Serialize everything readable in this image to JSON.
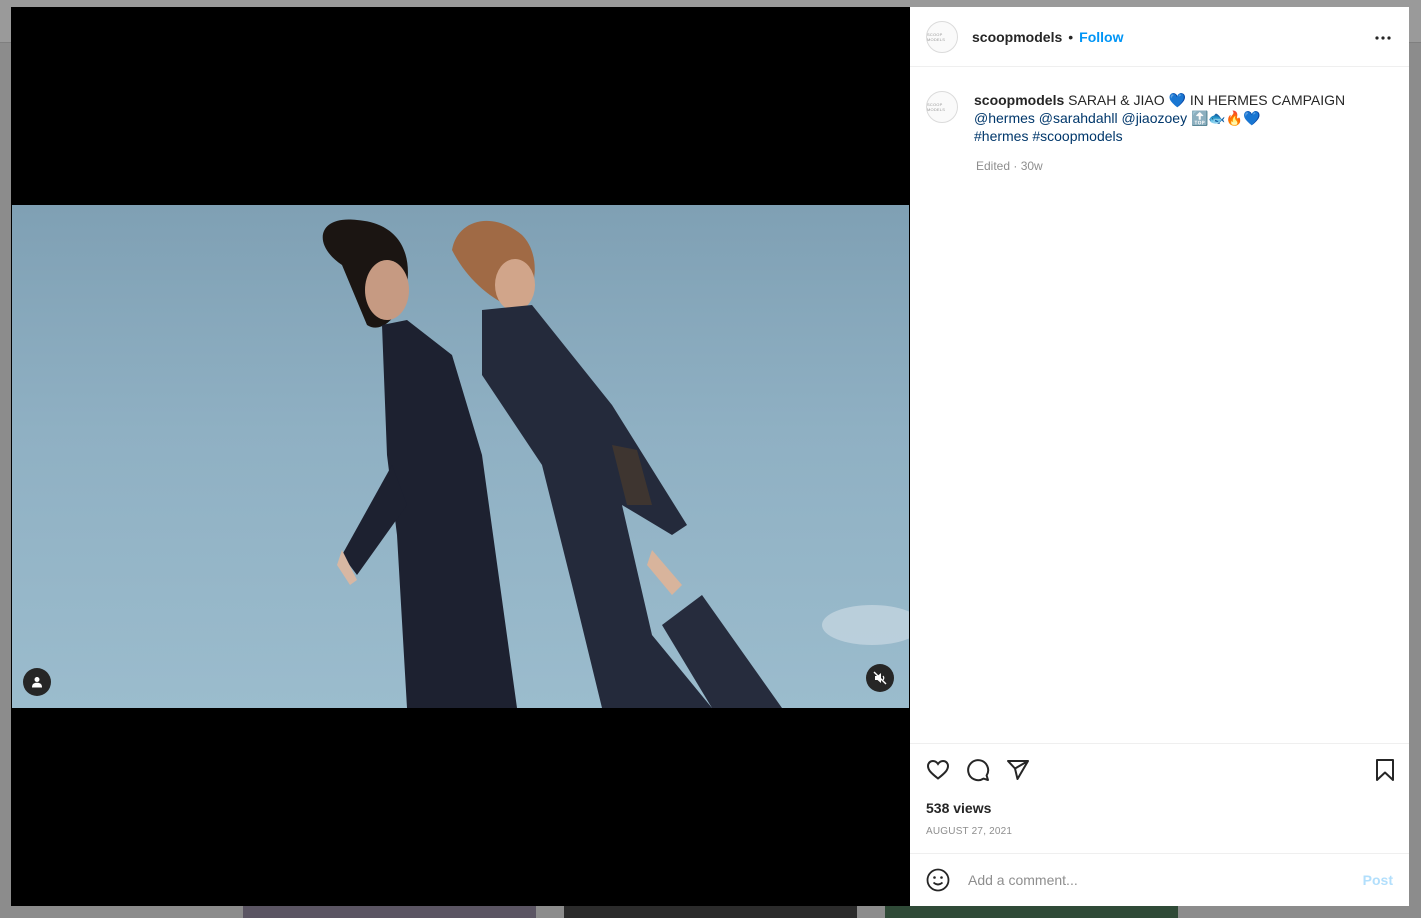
{
  "post": {
    "username": "scoopmodels",
    "dot": "•",
    "follow_label": "Follow",
    "avatar_text": "SCOOP MODELS",
    "caption": {
      "username": "scoopmodels",
      "line1_text": " SARAH & JIAO 💙 IN HERMES CAMPAIGN",
      "mentions": [
        "@hermes",
        "@sarahdahll",
        "@jiaozoey"
      ],
      "line2_emojis": "🔝🐟🔥💙",
      "hashtags": [
        "#hermes",
        "#scoopmodels"
      ]
    },
    "edited": "Edited · 30w",
    "views": "538 views",
    "date": "AUGUST 27, 2021",
    "comment_placeholder": "Add a comment...",
    "post_label": "Post"
  },
  "icons": {
    "more": "more-horizontal-icon",
    "like": "heart-icon",
    "comment": "comment-bubble-icon",
    "share": "paper-plane-icon",
    "save": "bookmark-icon",
    "emoji": "smiley-icon",
    "tag": "user-tag-icon",
    "mute": "volume-muted-icon"
  },
  "colors": {
    "follow": "#0095f6",
    "mention": "#00376b",
    "post_disabled": "#b2dffc",
    "secondary_text": "#8e8e8e"
  }
}
